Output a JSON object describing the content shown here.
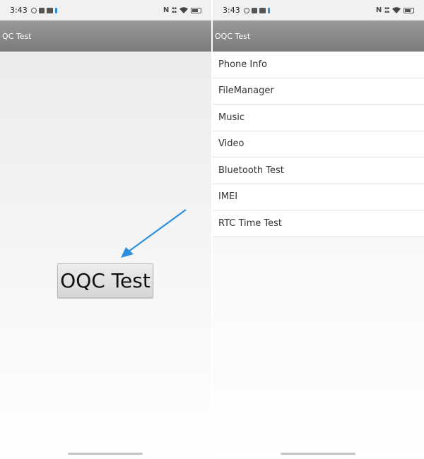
{
  "left_screen": {
    "status_bar": {
      "time": "3:43"
    },
    "app_bar": {
      "title": "QC Test"
    },
    "main_button": {
      "label": "OQC Test"
    },
    "annotation": {
      "arrow_color": "#2a8fe0"
    }
  },
  "right_screen": {
    "status_bar": {
      "time": "3:43"
    },
    "app_bar": {
      "title": "OQC Test"
    },
    "menu": {
      "items": [
        {
          "label": "Phone Info"
        },
        {
          "label": "FileManager"
        },
        {
          "label": "Music"
        },
        {
          "label": "Video"
        },
        {
          "label": "Bluetooth Test"
        },
        {
          "label": "IMEI"
        },
        {
          "label": "RTC Time Test"
        }
      ]
    }
  },
  "colors": {
    "app_bar": "#8a8a8a",
    "accent_arrow": "#2a8fe0"
  }
}
